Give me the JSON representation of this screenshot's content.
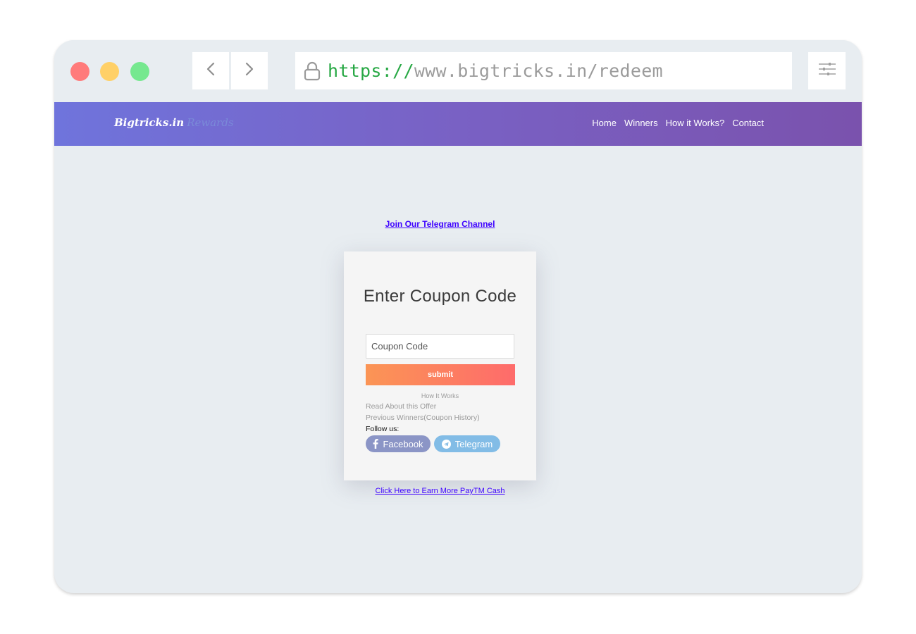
{
  "browser": {
    "url_scheme": "https://",
    "url_rest": "www.bigtricks.in/redeem",
    "controls": {
      "close_color": "#ff7b7b",
      "minimize_color": "#ffd067",
      "maximize_color": "#76e88f"
    },
    "icons": [
      "back-arrow-icon",
      "forward-arrow-icon",
      "lock-icon",
      "settings-sliders-icon"
    ]
  },
  "header": {
    "logo_text": "Bigtricks.in",
    "logo_sub": "Rewards",
    "nav": [
      "Home",
      "Winners",
      "How it Works?",
      "Contact"
    ],
    "gradient_start": "#6f74dc",
    "gradient_end": "#7a52ad"
  },
  "main": {
    "telegram_link": "Join Our Telegram Channel",
    "card": {
      "title": "Enter Coupon Code",
      "input_placeholder": "Coupon Code",
      "input_value": "",
      "submit_label": "submit",
      "how_it_works": "How It Works",
      "read_offer": "Read About this Offer",
      "previous_winners": "Previous Winners(Coupon History)",
      "follow_label": "Follow us:",
      "social": {
        "facebook": "Facebook",
        "telegram": "Telegram"
      }
    },
    "earn_link": "Click Here to Earn More PayTM Cash"
  }
}
